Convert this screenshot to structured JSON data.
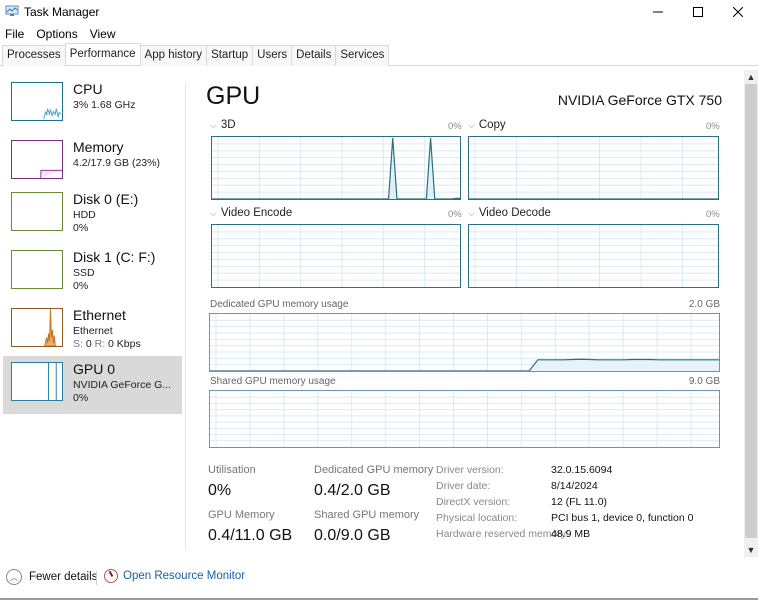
{
  "window": {
    "title": "Task Manager",
    "icon": "task-manager-icon",
    "controls": {
      "minimize": "minimize-icon",
      "maximize": "maximize-icon",
      "close": "close-icon"
    }
  },
  "menu": [
    {
      "label": "File"
    },
    {
      "label": "Options"
    },
    {
      "label": "View"
    }
  ],
  "tabs": [
    {
      "label": "Processes",
      "active": false
    },
    {
      "label": "Performance",
      "active": true
    },
    {
      "label": "App history",
      "active": false
    },
    {
      "label": "Startup",
      "active": false
    },
    {
      "label": "Users",
      "active": false
    },
    {
      "label": "Details",
      "active": false
    },
    {
      "label": "Services",
      "active": false
    }
  ],
  "sidebar": {
    "items": [
      {
        "title": "CPU",
        "line1": "3% 1.68 GHz",
        "line2": "",
        "color": "#117dbb",
        "active": false
      },
      {
        "title": "Memory",
        "line1": "4.2/17.9 GB (23%)",
        "line2": "",
        "color": "#8b12ae",
        "active": false
      },
      {
        "title": "Disk 0 (E:)",
        "line1": "HDD",
        "line2": "0%",
        "color": "#4da60c",
        "active": false
      },
      {
        "title": "Disk 1 (C: F:)",
        "line1": "SSD",
        "line2": "0%",
        "color": "#4da60c",
        "active": false
      },
      {
        "title": "Ethernet",
        "line1": "Ethernet",
        "line2_parts": {
          "s_label": "S:",
          "s_value": "0",
          "r_label": "R:",
          "r_value": "0 Kbps"
        },
        "color": "#a74f01",
        "active": false
      },
      {
        "title": "GPU 0",
        "line1": "NVIDIA GeForce G...",
        "line2": "0%",
        "color": "#2f96c6",
        "active": true
      }
    ]
  },
  "main": {
    "title": "GPU",
    "model": "NVIDIA GeForce GTX 750",
    "engines": [
      {
        "label": "3D",
        "value": "0%"
      },
      {
        "label": "Copy",
        "value": "0%"
      },
      {
        "label": "Video Encode",
        "value": "0%"
      },
      {
        "label": "Video Decode",
        "value": "0%"
      }
    ],
    "dedicated_memory": {
      "label": "Dedicated GPU memory usage",
      "max": "2.0 GB"
    },
    "shared_memory": {
      "label": "Shared GPU memory usage",
      "max": "9.0 GB"
    },
    "stats": {
      "utilisation_label": "Utilisation",
      "utilisation_value": "0%",
      "dedicated_label": "Dedicated GPU memory",
      "dedicated_value": "0.4/2.0 GB",
      "gpu_memory_label": "GPU Memory",
      "gpu_memory_value": "0.4/11.0 GB",
      "shared_label": "Shared GPU memory",
      "shared_value": "0.0/9.0 GB"
    },
    "info": [
      {
        "key": "Driver version:",
        "value": "32.0.15.6094"
      },
      {
        "key": "Driver date:",
        "value": "8/14/2024"
      },
      {
        "key": "DirectX version:",
        "value": "12 (FL 11.0)"
      },
      {
        "key": "Physical location:",
        "value": "PCI bus 1, device 0, function 0"
      },
      {
        "key": "Hardware reserved memory:",
        "value": "48.9 MB"
      }
    ]
  },
  "graphs_series": {
    "engine_3d_pct": [
      0,
      0,
      0,
      0,
      0,
      0,
      0,
      0,
      0,
      0,
      0,
      0,
      0,
      0,
      0,
      0,
      0,
      0,
      0,
      0,
      0,
      0,
      0,
      0,
      0,
      0,
      0,
      0,
      0,
      0,
      0,
      0,
      0,
      0,
      0,
      0,
      0,
      0,
      0,
      0,
      0,
      0,
      0,
      100,
      0,
      0,
      0,
      0,
      0,
      0,
      0,
      0,
      100,
      0,
      0,
      0,
      0,
      0,
      1,
      1
    ],
    "copy_pct": [
      0,
      0,
      0,
      0,
      0,
      0,
      0,
      0,
      0,
      0,
      0,
      0,
      0,
      0,
      0,
      0,
      0,
      0,
      0,
      0,
      0,
      0,
      0,
      0,
      0,
      0,
      0,
      0,
      0,
      0,
      0,
      0,
      0,
      0,
      0,
      0,
      0,
      0,
      0,
      0,
      0,
      0,
      0,
      0,
      0,
      0,
      0,
      0,
      0,
      0,
      0,
      0,
      0,
      0,
      0,
      0,
      0,
      0,
      0,
      0
    ],
    "video_encode_pct": [],
    "video_decode_pct": [],
    "dedicated_memory_gb": [
      0,
      0,
      0,
      0,
      0,
      0,
      0,
      0,
      0,
      0,
      0,
      0,
      0,
      0,
      0,
      0,
      0,
      0,
      0,
      0,
      0,
      0,
      0,
      0,
      0,
      0,
      0,
      0,
      0,
      0,
      0,
      0,
      0,
      0,
      0,
      0,
      0,
      0,
      0.4,
      0.4,
      0.4,
      0.4,
      0.41,
      0.42,
      0.41,
      0.4,
      0.4,
      0.4,
      0.4,
      0.41,
      0.41,
      0.41,
      0.4,
      0.4,
      0.4,
      0.4,
      0.4,
      0.4,
      0.4,
      0.4
    ],
    "shared_memory_gb": []
  },
  "footer": {
    "fewer_details": "Fewer details",
    "resource_monitor": "Open Resource Monitor"
  },
  "scrollbar": {
    "up": "▲",
    "down": "▼"
  }
}
